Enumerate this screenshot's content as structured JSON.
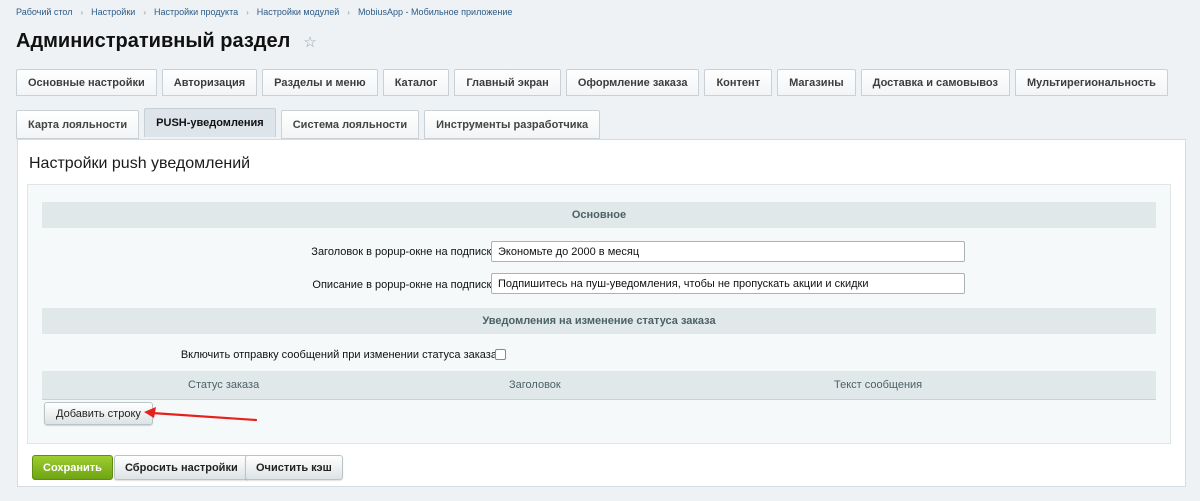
{
  "breadcrumb": [
    "Рабочий стол",
    "Настройки",
    "Настройки продукта",
    "Настройки модулей",
    "MobiusApp - Мобильное приложение"
  ],
  "breadcrumb_separator": "›",
  "page_title": "Административный раздел",
  "star_icon": "☆",
  "tabs_primary": [
    "Основные настройки",
    "Авторизация",
    "Разделы и меню",
    "Каталог",
    "Главный экран",
    "Оформление заказа",
    "Контент",
    "Магазины",
    "Доставка и самовывоз",
    "Мультирегиональность"
  ],
  "tabs_secondary": [
    "Карта лояльности",
    "PUSH-уведомления",
    "Система лояльности",
    "Инструменты разработчика"
  ],
  "active_secondary_tab": "PUSH-уведомления",
  "section_title": "Настройки push уведомлений",
  "groups": {
    "main": "Основное",
    "status": "Уведомления на изменение статуса заказа"
  },
  "fields": {
    "popup_title_label": "Заголовок в popup-окне на подписку:",
    "popup_title_value": "Экономьте до 2000 в месяц",
    "popup_desc_label": "Описание в popup-окне на подписку:",
    "popup_desc_value": "Подпишитесь на пуш-уведомления, чтобы не пропускать акции и скидки",
    "enable_label": "Включить отправку сообщений при изменении статуса заказа:",
    "enable_checked": false
  },
  "table": {
    "columns": [
      "Статус заказа",
      "Заголовок",
      "Текст сообщения"
    ]
  },
  "add_row_label": "Добавить строку",
  "buttons": {
    "save": "Сохранить",
    "reset": "Сбросить настройки",
    "clear_cache": "Очистить кэш"
  },
  "colors": {
    "accent_green": "#7ab51d",
    "arrow_red": "#e8201a",
    "link_blue": "#2c5b87"
  }
}
